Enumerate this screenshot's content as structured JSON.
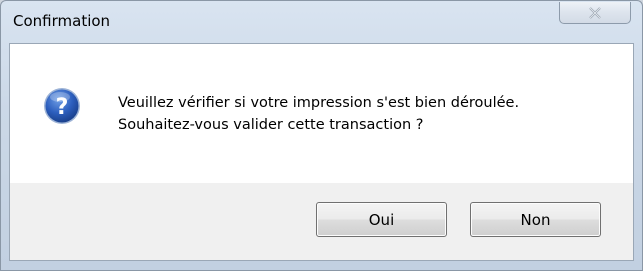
{
  "window": {
    "title": "Confirmation"
  },
  "dialog": {
    "icon": "question-icon",
    "message_line1": "Veuillez vérifier si votre impression s'est bien déroulée.",
    "message_line2": "Souhaitez-vous valider cette transaction ?"
  },
  "buttons": {
    "yes_label": "Oui",
    "no_label": "Non"
  },
  "colors": {
    "icon_blue": "#2a5db8",
    "frame": "#c2d0e1"
  }
}
